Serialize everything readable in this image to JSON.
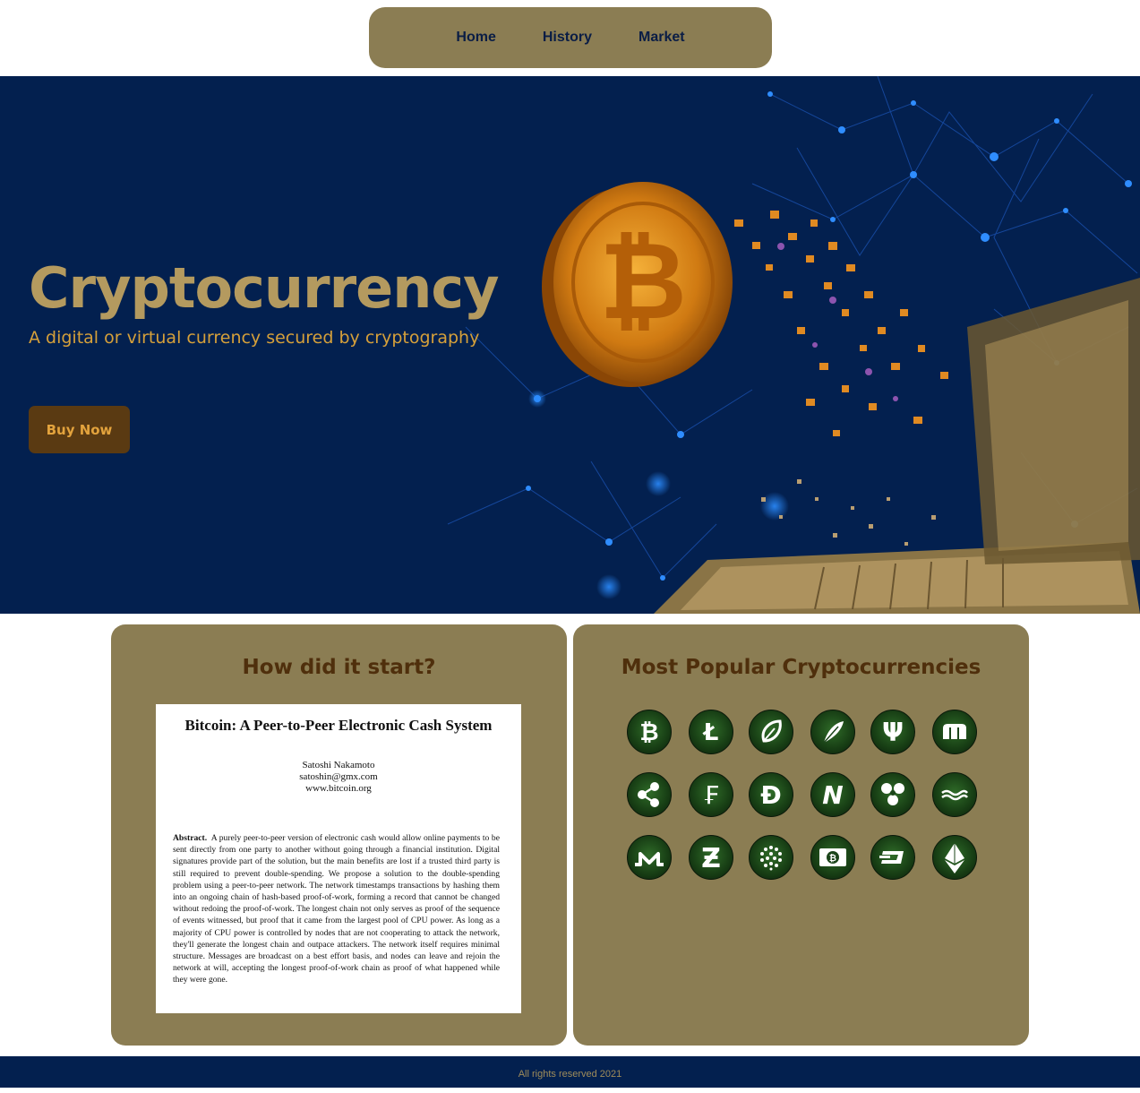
{
  "nav": {
    "items": [
      "Home",
      "History",
      "Market"
    ]
  },
  "hero": {
    "title": "Cryptocurrency",
    "subtitle": "A digital or virtual currency secured by cryptography",
    "cta": "Buy Now"
  },
  "start_card": {
    "heading": "How did it start?",
    "paper": {
      "title": "Bitcoin: A Peer-to-Peer Electronic Cash System",
      "author": "Satoshi Nakamoto",
      "email": "satoshin@gmx.com",
      "site": "www.bitcoin.org",
      "abstract_label": "Abstract.",
      "abstract": "A purely peer-to-peer version of electronic cash would allow online payments to be sent directly from one party to another without going through a financial institution. Digital signatures provide part of the solution, but the main benefits are lost if a trusted third party is still required to prevent double-spending. We propose a solution to the double-spending problem using a peer-to-peer network. The network timestamps transactions by hashing them into an ongoing chain of hash-based proof-of-work, forming a record that cannot be changed without redoing the proof-of-work. The longest chain not only serves as proof of the sequence of events witnessed, but proof that it came from the largest pool of CPU power. As long as a majority of CPU power is controlled by nodes that are not cooperating to attack the network, they'll generate the longest chain and outpace attackers. The network itself requires minimal structure. Messages are broadcast on a best effort basis, and nodes can leave and rejoin the network at will, accepting the longest proof-of-work chain as proof of what happened while they were gone."
    }
  },
  "popular_card": {
    "heading": "Most Popular Cryptocurrencies",
    "coins": [
      "bitcoin-icon",
      "litecoin-icon",
      "peercoin-icon",
      "feathercoin-icon",
      "primecoin-icon",
      "mastercoin-icon",
      "ripple-icon",
      "freicoin-icon",
      "dogecoin-icon",
      "namecoin-icon",
      "rio-icon",
      "nxt-icon",
      "monero-icon",
      "zcash-icon",
      "iota-icon",
      "bitcoin-cash-icon",
      "dash-icon",
      "ethereum-icon"
    ]
  },
  "footer": {
    "text": "All rights reserved 2021"
  },
  "colors": {
    "navy": "#03204f",
    "khaki": "#8b7d53",
    "gold": "#b49a5f",
    "orange": "#d6a03a",
    "brown": "#5a3a12"
  }
}
